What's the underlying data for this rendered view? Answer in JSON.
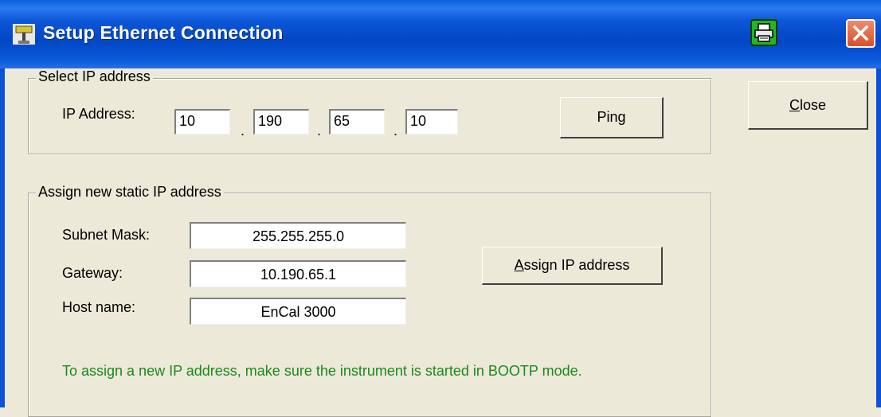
{
  "window": {
    "title": "Setup Ethernet Connection",
    "icons": {
      "app": "network-cable-icon",
      "printer": "printer-icon",
      "close": "close-x-icon"
    },
    "colors": {
      "titlebar": "#0b52d8",
      "dialog_bg": "#ece9d8",
      "note_text": "#1a8a1a",
      "close_button": "#d9502c",
      "printer_button": "#25b425"
    }
  },
  "select_ip": {
    "legend": "Select IP address",
    "ip_label": "IP Address:",
    "octets": [
      "10",
      "190",
      "65",
      "10"
    ],
    "separator": ".",
    "ping_label": "Ping"
  },
  "assign": {
    "legend": "Assign new static IP address",
    "subnet_label": "Subnet Mask:",
    "subnet_value": "255.255.255.0",
    "gateway_label": "Gateway:",
    "gateway_value": "10.190.65.1",
    "host_label": "Host name:",
    "host_value": "EnCal 3000",
    "assign_button": {
      "mnemonic": "A",
      "rest": "ssign IP address"
    },
    "note": "To assign a new IP address, make sure the instrument is started in BOOTP mode."
  },
  "close_button": {
    "mnemonic": "C",
    "rest": "lose"
  }
}
